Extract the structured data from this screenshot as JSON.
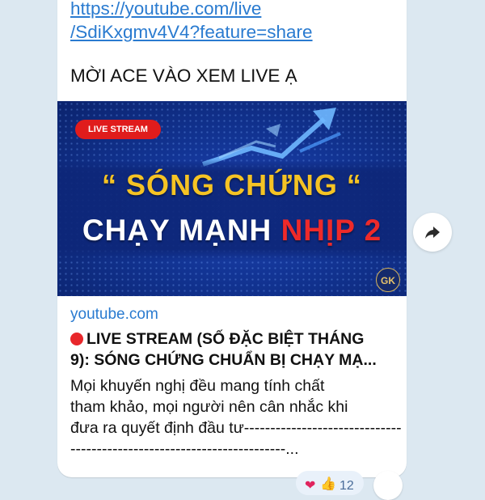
{
  "message": {
    "link_lines": [
      "https://youtube.com/live",
      "/SdiKxgmv4V4?feature=share"
    ],
    "text": "MỜI ACE VÀO XEM LIVE Ạ"
  },
  "thumbnail": {
    "badge": "LIVE STREAM",
    "line1": "“ SÓNG CHỨNG “",
    "line2_white": "CHẠY MẠNH ",
    "line2_red": "NHỊP 2",
    "logo": "GK"
  },
  "preview": {
    "domain": "youtube.com",
    "title_line1": "LIVE STREAM (SỐ ĐẶC BIỆT THÁNG",
    "title_line2": "9): SÓNG CHỨNG CHUẨN BỊ CHẠY MẠ...",
    "desc_lines": [
      "Mọi khuyến nghị đều mang tính chất",
      "tham khảo, mọi người nên cân nhắc khi",
      "đưa ra quyết định đầu tư------------------------------",
      "-----------------------------------------..."
    ]
  },
  "reactions": {
    "count": "12"
  },
  "colors": {
    "link": "#2a7bd0",
    "background": "#dce8f1",
    "accent_red": "#e01c1c",
    "gold": "#f5c324"
  },
  "icons": {
    "share": "share-arrow-icon",
    "heart": "heart-icon",
    "thumbs": "thumbs-up-icon",
    "add_reaction": "add-reaction-icon"
  }
}
